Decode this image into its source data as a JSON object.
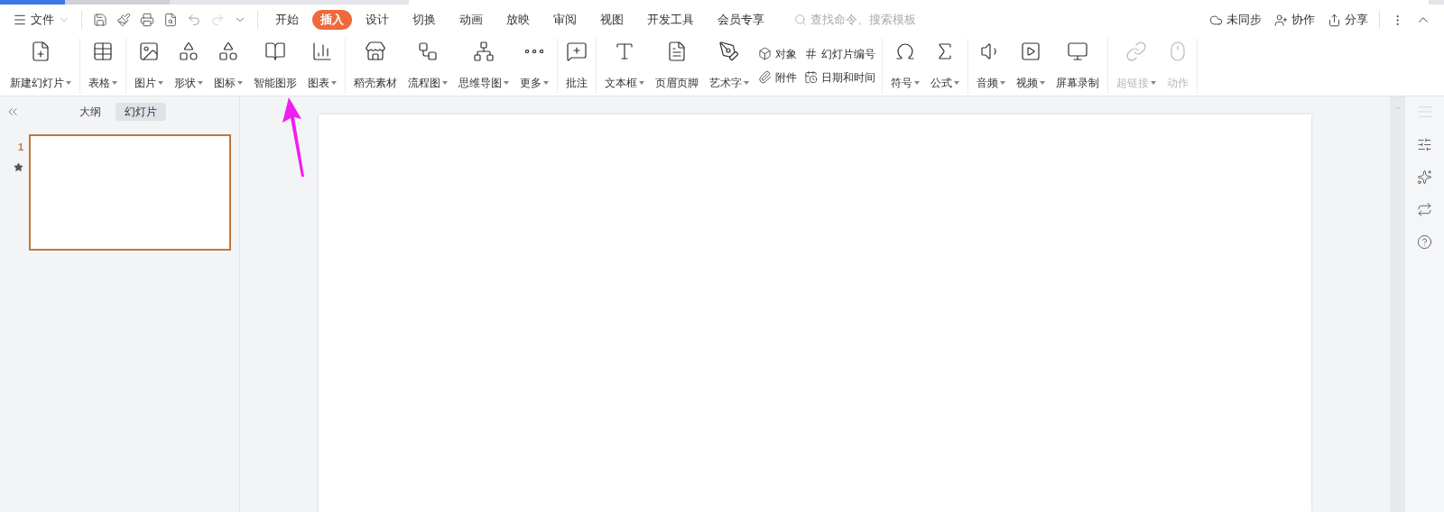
{
  "menu_bar": {
    "file_menu": "文件",
    "tabs": [
      {
        "label": "开始",
        "selected": false
      },
      {
        "label": "插入",
        "selected": true
      },
      {
        "label": "设计",
        "selected": false
      },
      {
        "label": "切换",
        "selected": false
      },
      {
        "label": "动画",
        "selected": false
      },
      {
        "label": "放映",
        "selected": false
      },
      {
        "label": "审阅",
        "selected": false
      },
      {
        "label": "视图",
        "selected": false
      },
      {
        "label": "开发工具",
        "selected": false
      },
      {
        "label": "会员专享",
        "selected": false
      }
    ],
    "search": {
      "placeholder": "查找命令、搜索模板"
    },
    "actions": [
      "未同步",
      "协作",
      "分享"
    ]
  },
  "ribbon": {
    "groups": [
      {
        "items": [
          {
            "kind": "large",
            "label": "新建幻灯片",
            "dropdown": true,
            "disabled": false
          }
        ]
      },
      {
        "items": [
          {
            "kind": "large",
            "label": "表格",
            "dropdown": true,
            "disabled": false
          }
        ]
      },
      {
        "items": [
          {
            "kind": "large",
            "label": "图片",
            "dropdown": true,
            "disabled": false
          },
          {
            "kind": "large",
            "label": "形状",
            "dropdown": true,
            "disabled": false
          },
          {
            "kind": "large",
            "label": "图标",
            "dropdown": true,
            "disabled": false
          },
          {
            "kind": "large",
            "label": "智能图形",
            "dropdown": false,
            "disabled": false
          },
          {
            "kind": "large",
            "label": "图表",
            "dropdown": true,
            "disabled": false
          }
        ]
      },
      {
        "items": [
          {
            "kind": "large",
            "label": "稻壳素材",
            "dropdown": false,
            "disabled": false
          },
          {
            "kind": "large",
            "label": "流程图",
            "dropdown": true,
            "disabled": false
          },
          {
            "kind": "large",
            "label": "思维导图",
            "dropdown": true,
            "disabled": false
          },
          {
            "kind": "large",
            "label": "更多",
            "dropdown": true,
            "disabled": false
          }
        ]
      },
      {
        "items": [
          {
            "kind": "large",
            "label": "批注",
            "dropdown": false,
            "disabled": false
          }
        ]
      },
      {
        "items": [
          {
            "kind": "large",
            "label": "文本框",
            "dropdown": true,
            "disabled": false
          },
          {
            "kind": "large",
            "label": "页眉页脚",
            "dropdown": false,
            "disabled": false
          },
          {
            "kind": "large",
            "label": "艺术字",
            "dropdown": true,
            "disabled": false
          },
          {
            "kind": "small",
            "label": "对象",
            "dropdown": false,
            "disabled": false
          },
          {
            "kind": "small",
            "label": "附件",
            "dropdown": false,
            "disabled": false
          },
          {
            "kind": "small",
            "label": "幻灯片编号",
            "dropdown": false,
            "disabled": false
          },
          {
            "kind": "small",
            "label": "日期和时间",
            "dropdown": false,
            "disabled": false
          }
        ]
      },
      {
        "items": [
          {
            "kind": "large",
            "label": "符号",
            "dropdown": true,
            "disabled": false
          },
          {
            "kind": "large",
            "label": "公式",
            "dropdown": true,
            "disabled": false
          }
        ]
      },
      {
        "items": [
          {
            "kind": "large",
            "label": "音频",
            "dropdown": true,
            "disabled": false
          },
          {
            "kind": "large",
            "label": "视频",
            "dropdown": true,
            "disabled": false
          },
          {
            "kind": "large",
            "label": "屏幕录制",
            "dropdown": false,
            "disabled": false
          }
        ]
      },
      {
        "items": [
          {
            "kind": "large",
            "label": "超链接",
            "dropdown": true,
            "disabled": true
          },
          {
            "kind": "large",
            "label": "动作",
            "dropdown": false,
            "disabled": true
          }
        ]
      }
    ]
  },
  "sidebar": {
    "tabs": [
      {
        "label": "大纲",
        "selected": false
      },
      {
        "label": "幻灯片",
        "selected": true
      }
    ],
    "slides": [
      {
        "number": "1",
        "selected": true
      }
    ]
  }
}
